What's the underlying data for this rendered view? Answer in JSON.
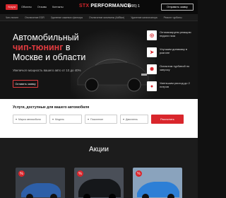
{
  "topbar": {
    "nav": [
      "Услуги",
      "Объекты",
      "Отзывы",
      "Контакты"
    ],
    "logo_stx": "STX",
    "logo_rest": " PERFORMANCE",
    "phone": "+7 (495) 1",
    "call_btn": "Отправить заявку"
  },
  "servnav": {
    "items": [
      "Чип-тюнинг",
      "Отключение EGR",
      "Удаление сажевого фильтра",
      "Отключение мочевины (AdBlue)",
      "Удаление катализатора",
      "Ремонт турбины"
    ]
  },
  "hero": {
    "title_line1": "Автомобильный",
    "title_red": "чип-тюнинг",
    "title_line2_rest": " в",
    "title_line3": "Москве и области",
    "subtitle": "Увеличьте мощность вашего авто от 10 до 40%",
    "btn": "Оставить заявку",
    "features": [
      {
        "text": "Оптимизируем реакцию педали газа",
        "icon": "gauge-icon"
      },
      {
        "text": "Улучшим динамику в разгоне",
        "icon": "speed-icon"
      },
      {
        "text": "Оснастим турбиной по запросу",
        "icon": "turbo-icon"
      },
      {
        "text": "Уменьшим расход до 2 литров",
        "icon": "fuel-icon"
      }
    ]
  },
  "services": {
    "title": "Услуги, доступные для вашего автомобиля",
    "selects": [
      "Марка автомобиля",
      "Модель",
      "Поколение",
      "Двигатель"
    ],
    "calc_btn": "Рассчитать"
  },
  "promos": {
    "title": "Акции",
    "badge": "%"
  },
  "colors": {
    "accent": "#d9262c",
    "dark": "#111111"
  }
}
